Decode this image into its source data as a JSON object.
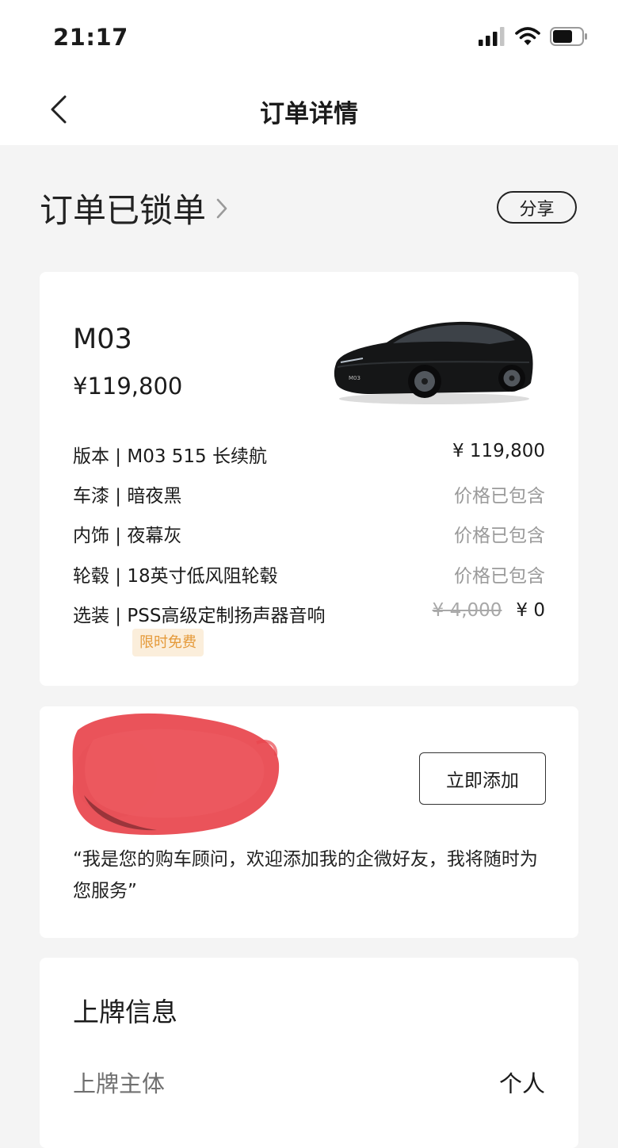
{
  "status_bar": {
    "time": "21:17"
  },
  "header": {
    "title": "订单详情"
  },
  "order": {
    "status": "订单已锁单",
    "share_label": "分享"
  },
  "car": {
    "model": "M03",
    "price": "¥119,800",
    "specs": [
      {
        "label": "版本 | M03 515 长续航",
        "value": "¥ 119,800"
      },
      {
        "label": "车漆 | 暗夜黑",
        "value": "价格已包含"
      },
      {
        "label": "内饰 | 夜幕灰",
        "value": "价格已包含"
      },
      {
        "label": "轮毂 | 18英寸低风阻轮毂",
        "value": "价格已包含"
      },
      {
        "label": "选装 | PSS高级定制扬声器音响",
        "original_price": "¥ 4,000",
        "value": "¥ 0"
      }
    ],
    "promo_badge": "限时免费",
    "badge_text": "M03"
  },
  "advisor": {
    "add_label": "立即添加",
    "message": "“我是您的购车顾问，欢迎添加我的企微好友，我将随时为您服务”"
  },
  "plate": {
    "title": "上牌信息",
    "subject_label": "上牌主体",
    "subject_value": "个人"
  },
  "colors": {
    "promo_text": "#e59a3a",
    "promo_bg": "#fbeedb",
    "redaction": "#e8464d",
    "page_bg": "#f4f4f4"
  }
}
